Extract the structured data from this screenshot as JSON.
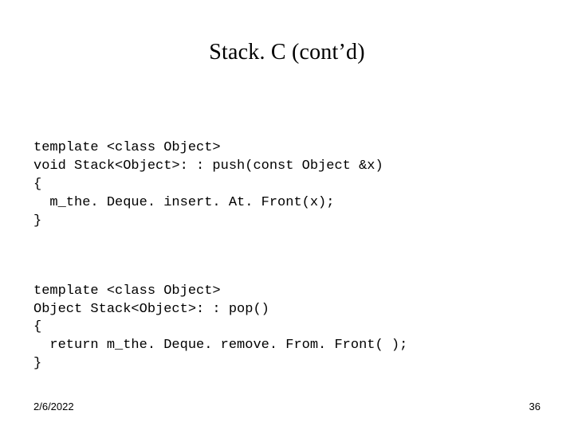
{
  "title": "Stack. C (cont’d)",
  "code_block1": {
    "l1": "template <class Object>",
    "l2": "void Stack<Object>: : push(const Object &x)",
    "l3": "{",
    "l4": "  m_the. Deque. insert. At. Front(x);",
    "l5": "}"
  },
  "code_block2": {
    "l1": "template <class Object>",
    "l2": "Object Stack<Object>: : pop()",
    "l3": "{",
    "l4": "  return m_the. Deque. remove. From. Front( );",
    "l5": "}"
  },
  "footer": {
    "date": "2/6/2022",
    "page": "36"
  }
}
